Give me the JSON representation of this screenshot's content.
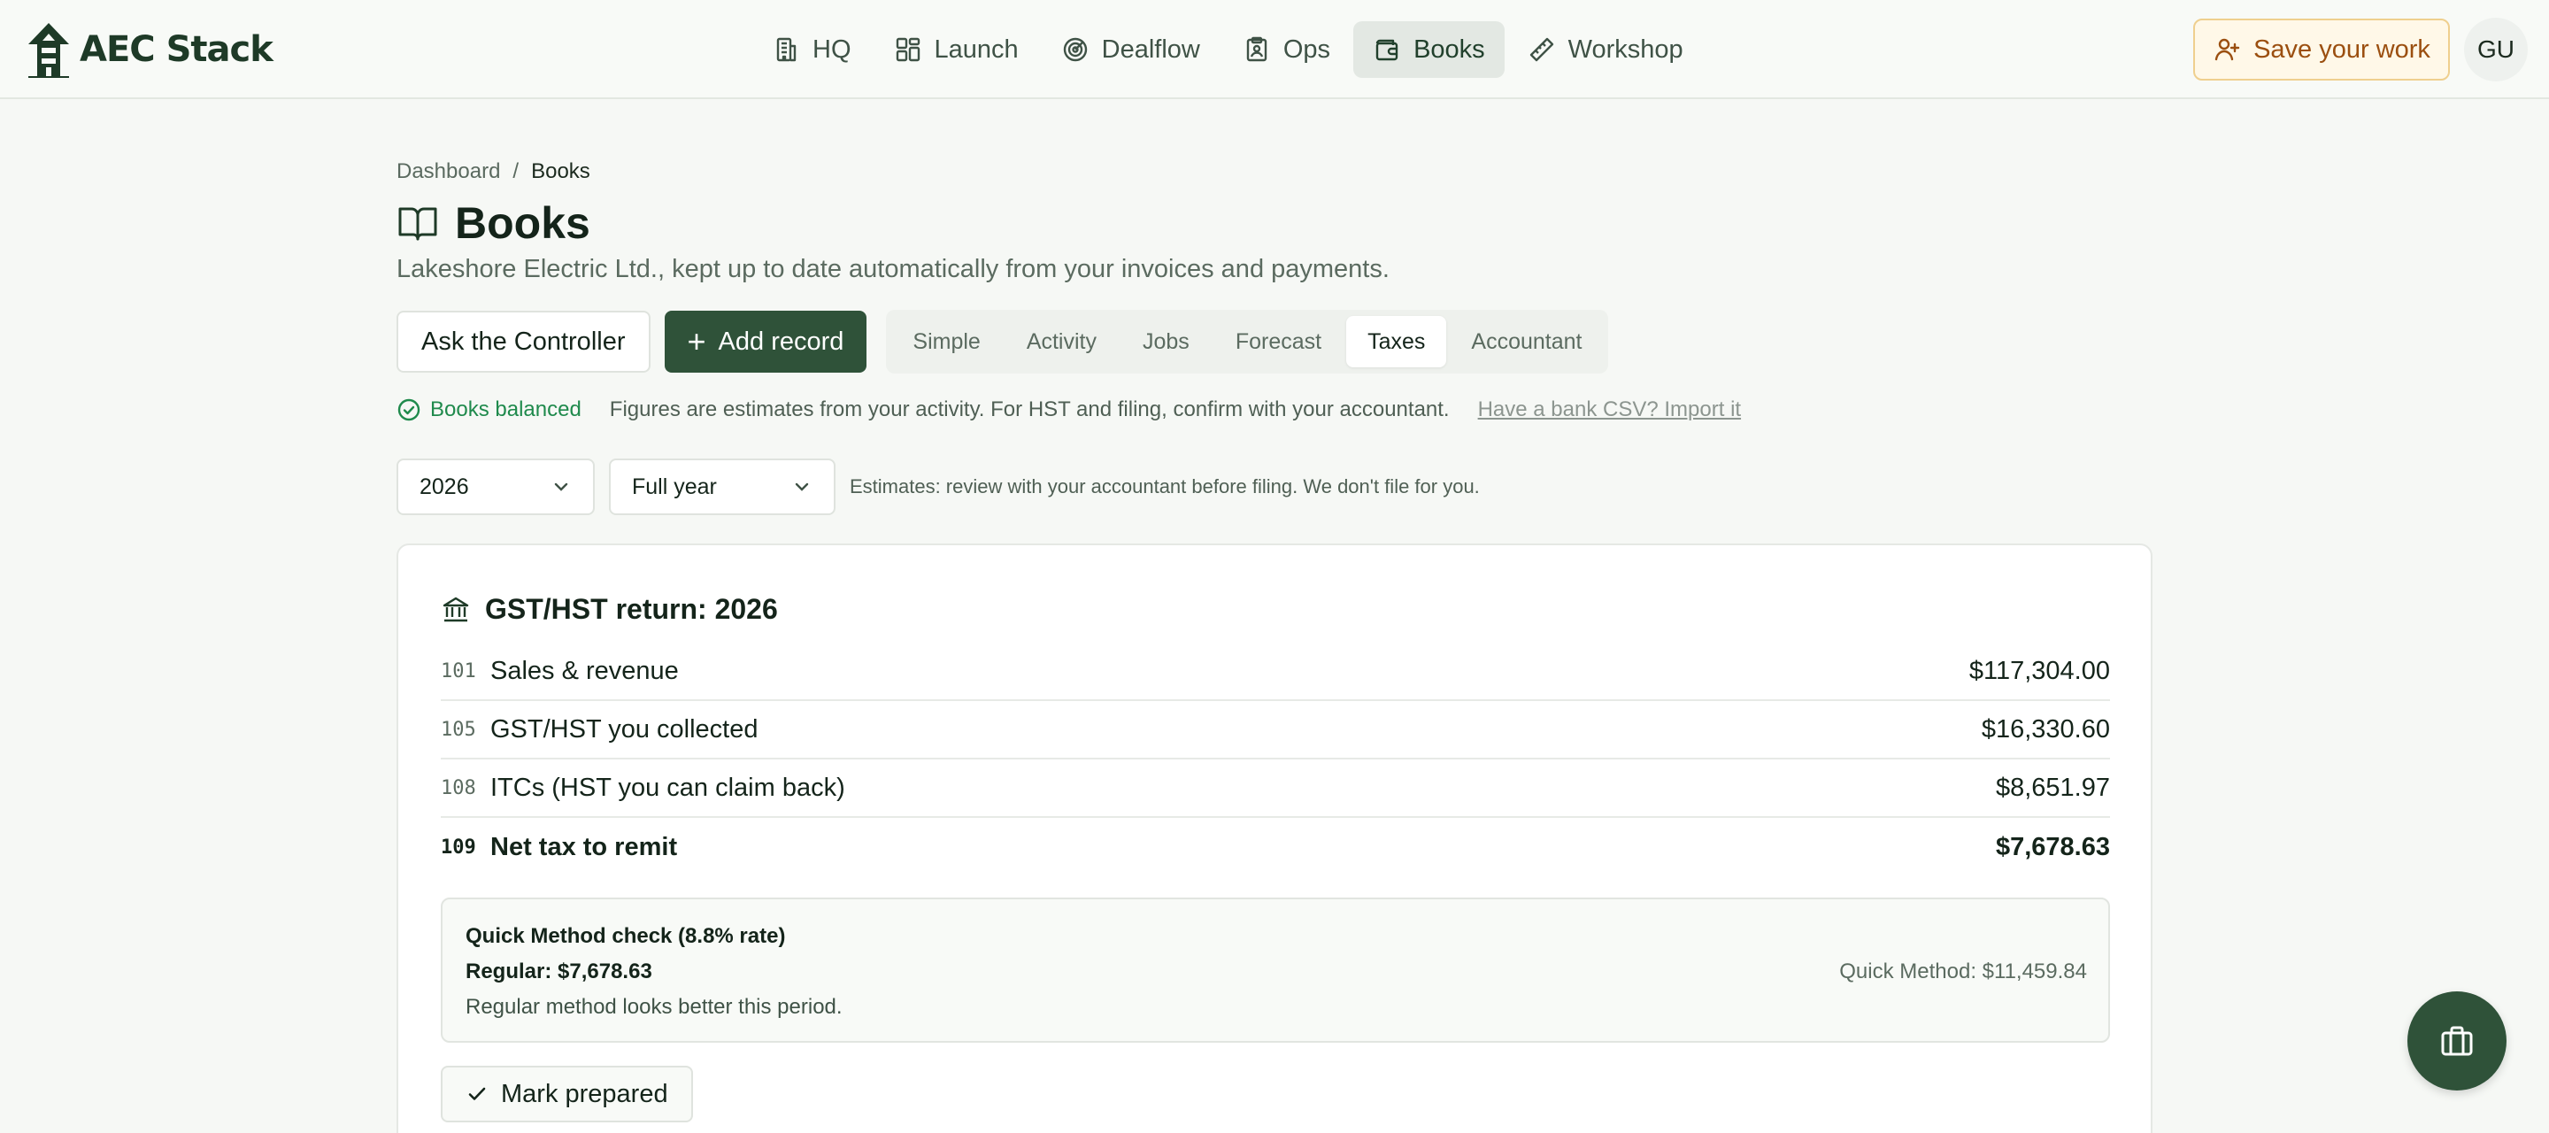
{
  "brand": {
    "name": "AEC Stack"
  },
  "nav": {
    "items": [
      {
        "label": "HQ",
        "icon": "building-icon"
      },
      {
        "label": "Launch",
        "icon": "grid-icon"
      },
      {
        "label": "Dealflow",
        "icon": "target-icon"
      },
      {
        "label": "Ops",
        "icon": "clipboard-icon"
      },
      {
        "label": "Books",
        "icon": "wallet-icon",
        "active": true
      },
      {
        "label": "Workshop",
        "icon": "ruler-icon"
      }
    ],
    "save_label": "Save your work",
    "avatar_initials": "GU"
  },
  "breadcrumb": {
    "root": "Dashboard",
    "separator": "/",
    "current": "Books"
  },
  "page": {
    "title": "Books",
    "subtitle": "Lakeshore Electric Ltd., kept up to date automatically from your invoices and payments."
  },
  "actions": {
    "ask_label": "Ask the Controller",
    "add_label": "Add record"
  },
  "tabs": [
    {
      "label": "Simple"
    },
    {
      "label": "Activity"
    },
    {
      "label": "Jobs"
    },
    {
      "label": "Forecast"
    },
    {
      "label": "Taxes",
      "active": true
    },
    {
      "label": "Accountant"
    }
  ],
  "status": {
    "balanced_label": "Books balanced",
    "note": "Figures are estimates from your activity. For HST and filing, confirm with your accountant.",
    "import_link": "Have a bank CSV? Import it"
  },
  "filters": {
    "year": "2026",
    "period": "Full year",
    "note": "Estimates: review with your accountant before filing. We don't file for you."
  },
  "return": {
    "title": "GST/HST return: 2026",
    "lines": [
      {
        "code": "101",
        "label": "Sales & revenue",
        "amount": "$117,304.00"
      },
      {
        "code": "105",
        "label": "GST/HST you collected",
        "amount": "$16,330.60"
      },
      {
        "code": "108",
        "label": "ITCs (HST you can claim back)",
        "amount": "$8,651.97"
      },
      {
        "code": "109",
        "label": "Net tax to remit",
        "amount": "$7,678.63"
      }
    ],
    "quick_method": {
      "title": "Quick Method check (8.8% rate)",
      "regular": "Regular: $7,678.63",
      "note": "Regular method looks better this period.",
      "quick": "Quick Method: $11,459.84"
    },
    "mark_label": "Mark prepared"
  },
  "colors": {
    "brand_green": "#2f5239",
    "balanced_green": "#1f8a4c",
    "save_accent": "#9b4f10"
  }
}
